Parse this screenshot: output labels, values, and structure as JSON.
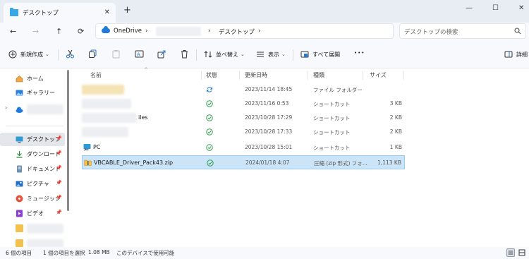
{
  "window": {
    "tab_title": "デスクトップ",
    "tab_close": "✕",
    "new_tab": "+",
    "controls": {
      "minimize": "—",
      "maximize": "☐",
      "close": "✕"
    }
  },
  "nav": {
    "back": "←",
    "forward": "→",
    "up": "↑",
    "refresh": "⟳"
  },
  "address": {
    "root": "OneDrive",
    "sep1": "›",
    "sep2": "›",
    "current": "デスクトップ",
    "sep3": "›"
  },
  "search": {
    "placeholder": "デスクトップの検索"
  },
  "commands": {
    "new_label": "新規作成",
    "sort_label": "並べ替え",
    "view_label": "表示",
    "expand_label": "すべて展開",
    "more": "•••",
    "details_label": "詳細"
  },
  "sidebar": {
    "items": [
      {
        "label": "ホーム",
        "icon": "home-icon"
      },
      {
        "label": "ギャラリー",
        "icon": "gallery-icon"
      },
      {
        "label": "",
        "icon": "cloud-icon"
      },
      {
        "label": "デスクトップ",
        "icon": "desktop-icon",
        "pin": "📌"
      },
      {
        "label": "ダウンロード",
        "icon": "download-icon",
        "pin": "📌"
      },
      {
        "label": "ドキュメント",
        "icon": "document-icon",
        "pin": "📌"
      },
      {
        "label": "ピクチャ",
        "icon": "picture-icon",
        "pin": "📌"
      },
      {
        "label": "ミュージック",
        "icon": "music-icon",
        "pin": "📌"
      },
      {
        "label": "ビデオ",
        "icon": "video-icon",
        "pin": "📌"
      }
    ]
  },
  "columns": {
    "name": "名前",
    "status": "状態",
    "date": "更新日時",
    "type": "種類",
    "size": "サイズ"
  },
  "files": [
    {
      "name": "",
      "status": "sync",
      "date": "2023/11/14 18:45",
      "type": "ファイル フォルダー",
      "size": ""
    },
    {
      "name": "",
      "status": "ok",
      "date": "2023/11/16 0:53",
      "type": "ショートカット",
      "size": "3 KB"
    },
    {
      "name": "iles",
      "status": "ok",
      "date": "2023/10/28 17:29",
      "type": "ショートカット",
      "size": "2 KB"
    },
    {
      "name": "",
      "status": "ok",
      "date": "2023/10/28 17:33",
      "type": "ショートカット",
      "size": "2 KB"
    },
    {
      "name": "PC",
      "status": "ok",
      "date": "2023/10/28 15:01",
      "type": "ショートカット",
      "size": "1 KB"
    },
    {
      "name": "VBCABLE_Driver_Pack43.zip",
      "status": "ok",
      "date": "2024/01/18 4:07",
      "type": "圧縮 (zip 形式) フォ...",
      "size": "1,113 KB"
    }
  ],
  "status_bar": {
    "item_count": "6 個の項目",
    "selected": "1 個の項目を選択",
    "selected_size": "1.08 MB",
    "availability": "このデバイスで使用可能"
  },
  "colors": {
    "accent": "#1f7ad8",
    "selection": "#cce4f7",
    "ok_green": "#2e9e4e"
  }
}
